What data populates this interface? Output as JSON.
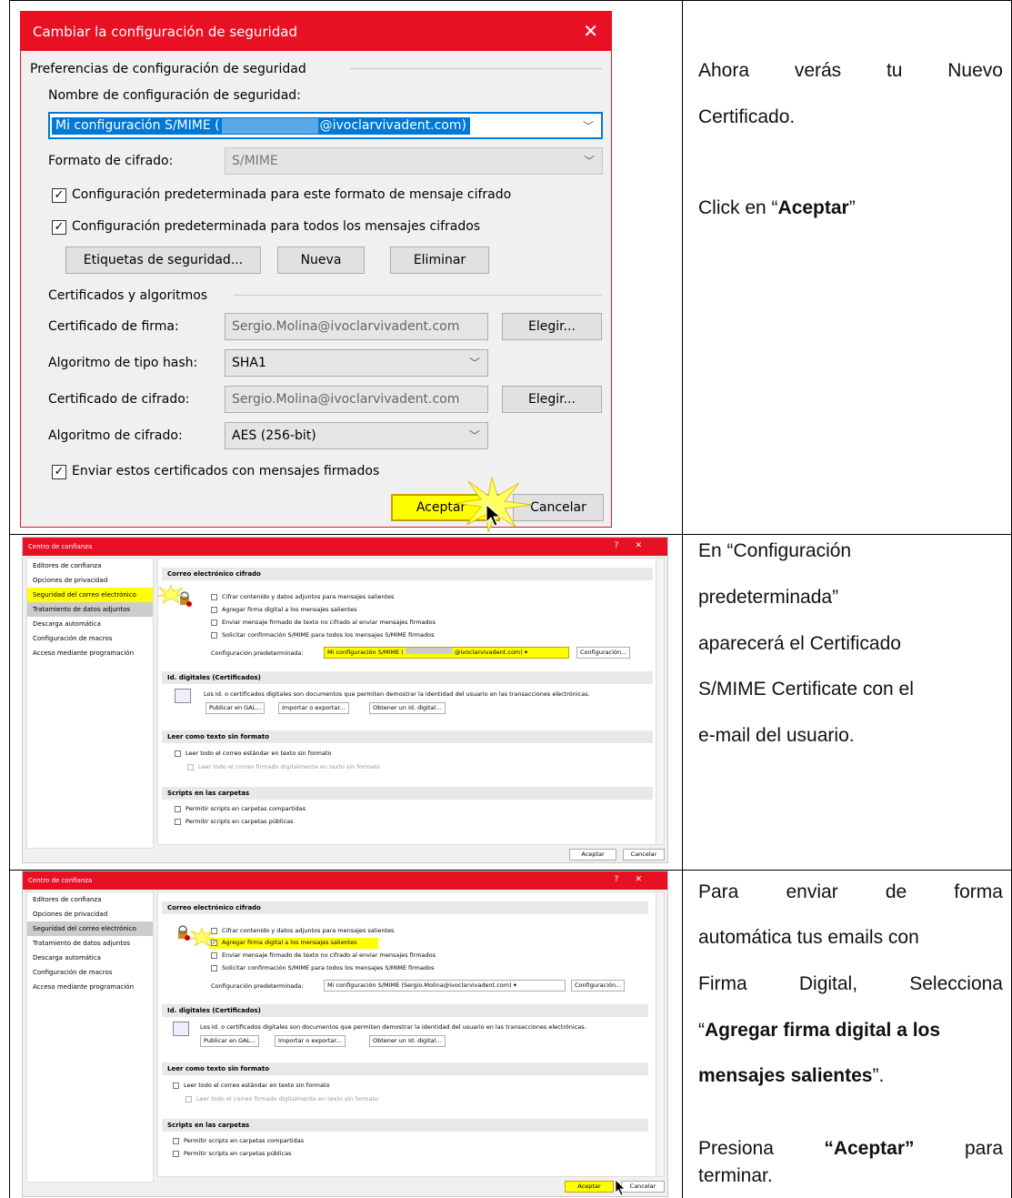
{
  "dialog1": {
    "title": "Cambiar la configuración de seguridad",
    "close": "✕",
    "group_prefs": "Preferencias de configuración de seguridad",
    "name_label": "Nombre de configuración de seguridad:",
    "name_value": "Mi configuración S/MIME (",
    "name_value_suffix": "@ivoclarvivadent.com)",
    "format_label": "Formato de cifrado:",
    "format_value": "S/MIME",
    "chk1": "Configuración predeterminada para este formato de mensaje cifrado",
    "chk2": "Configuración predeterminada para todos los mensajes cifrados",
    "btn_labels": "Etiquetas de seguridad...",
    "btn_new": "Nueva",
    "btn_delete": "Eliminar",
    "group_certs": "Certificados y algoritmos",
    "sign_cert_label": "Certificado de firma:",
    "sign_cert_value": "Sergio.Molina@ivoclarvivadent.com",
    "choose": "Elegir...",
    "hash_label": "Algoritmo de tipo hash:",
    "hash_value": "SHA1",
    "enc_cert_label": "Certificado de cifrado:",
    "enc_cert_value": "Sergio.Molina@ivoclarvivadent.com",
    "enc_alg_label": "Algoritmo de cifrado:",
    "enc_alg_value": "AES (256-bit)",
    "chk_send": "Enviar estos certificados con mensajes firmados",
    "ok": "Aceptar",
    "cancel": "Cancelar"
  },
  "row1_text": {
    "l1a": "Ahora",
    "l1b": "verás",
    "l1c": "tu",
    "l1d": "Nuevo",
    "l2": "Certificado.",
    "l3a": "Click en “",
    "l3b": "Aceptar",
    "l3c": "”"
  },
  "row2_text": {
    "l1": "En “Configuración",
    "l2": "predeterminada”",
    "l3": "aparecerá el Certificado",
    "l4": "S/MIME Certificate con el",
    "l5": "e-mail del usuario."
  },
  "row3_text": {
    "l1a": "Para",
    "l1b": "enviar",
    "l1c": "de",
    "l1d": "forma",
    "l2": "automática tus emails con",
    "l3a": "Firma",
    "l3b": "Digital,",
    "l3c": "Selecciona",
    "l4a": "“",
    "l4b": "Agregar firma digital a los",
    "l5a": "mensajes salientes",
    "l5b": "”.",
    "l6a": "Presiona",
    "l6b": "“Aceptar”",
    "l6c": "para",
    "l7": "terminar."
  },
  "trust": {
    "title": "Centro de confianza",
    "help": "?",
    "close": "✕",
    "sidebar": [
      "Editores de confianza",
      "Opciones de privacidad",
      "Seguridad del correo electrónico",
      "Tratamiento de datos adjuntos",
      "Descarga automática",
      "Configuración de macros",
      "Acceso mediante programación"
    ],
    "sect_email": "Correo electrónico cifrado",
    "opt1": "Cifrar contenido y datos adjuntos para mensajes salientes",
    "opt2": "Agregar firma digital a los mensajes salientes",
    "opt3": "Enviar mensaje firmado de texto no cifrado al enviar mensajes firmados",
    "opt4": "Solicitar confirmación S/MIME para todos los mensajes S/MIME firmados",
    "default_label": "Configuración predeterminada:",
    "default_value_a": "Mi configuración S/MIME (",
    "default_value_a_suffix": "@ivoclarvivadent.com)",
    "default_value_b": "Mi configuración S/MIME (Sergio.Molina@ivoclarvivadent.com)",
    "config_btn": "Configuración...",
    "sect_ids": "Id. digitales (Certificados)",
    "ids_text": "Los Id. o certificados digitales son documentos que permiten demostrar la identidad del usuario en las transacciones electrónicas.",
    "publish": "Publicar en GAL...",
    "import": "Importar o exportar...",
    "obtain": "Obtener un Id. digital...",
    "sect_plain": "Leer como texto sin formato",
    "plain1": "Leer todo el correo estándar en texto sin formato",
    "plain2": "Leer todo el correo firmado digitalmente en texto sin formato",
    "sect_scripts": "Scripts en las carpetas",
    "script1": "Permitir scripts en carpetas compartidas",
    "script2": "Permitir scripts en carpetas públicas",
    "ok": "Aceptar",
    "cancel": "Cancelar"
  },
  "colors": {
    "accent_red": "#e81123",
    "highlight": "#ffff00"
  }
}
